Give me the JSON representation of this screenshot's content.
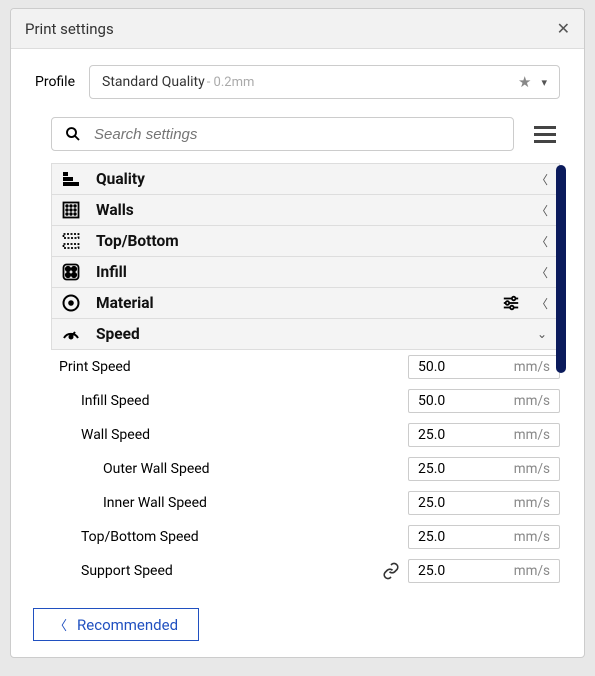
{
  "panel": {
    "title": "Print settings"
  },
  "profile": {
    "label": "Profile",
    "name": "Standard Quality",
    "sub": " - 0.2mm"
  },
  "search": {
    "placeholder": "Search settings"
  },
  "sections": {
    "quality": {
      "label": "Quality",
      "expanded": false
    },
    "walls": {
      "label": "Walls",
      "expanded": false
    },
    "topbottom": {
      "label": "Top/Bottom",
      "expanded": false
    },
    "infill": {
      "label": "Infill",
      "expanded": false
    },
    "material": {
      "label": "Material",
      "expanded": false,
      "has_settings_icon": true
    },
    "speed": {
      "label": "Speed",
      "expanded": true
    }
  },
  "speed": {
    "unit": "mm/s",
    "print_speed": {
      "label": "Print Speed",
      "value": "50.0"
    },
    "infill_speed": {
      "label": "Infill Speed",
      "value": "50.0"
    },
    "wall_speed": {
      "label": "Wall Speed",
      "value": "25.0"
    },
    "outer_wall": {
      "label": "Outer Wall Speed",
      "value": "25.0"
    },
    "inner_wall": {
      "label": "Inner Wall Speed",
      "value": "25.0"
    },
    "topbottom_speed": {
      "label": "Top/Bottom Speed",
      "value": "25.0"
    },
    "support_speed": {
      "label": "Support Speed",
      "value": "25.0",
      "linked": true
    }
  },
  "footer": {
    "recommended": "Recommended"
  }
}
